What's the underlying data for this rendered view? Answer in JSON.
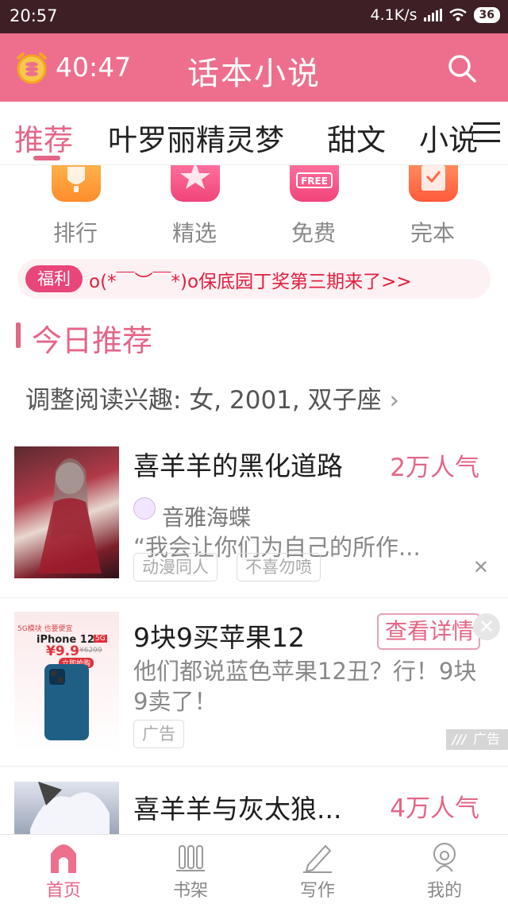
{
  "status": {
    "time": "20:57",
    "speed": "4.1K/s",
    "battery": "36"
  },
  "header": {
    "timer": "40:47",
    "title": "话本小说"
  },
  "tabs": [
    {
      "label": "推荐"
    },
    {
      "label": "叶罗丽精灵梦"
    },
    {
      "label": "甜文"
    },
    {
      "label": "小说"
    }
  ],
  "quick": [
    {
      "label": "排行",
      "icon": "trophy-icon"
    },
    {
      "label": "精选",
      "icon": "star-icon"
    },
    {
      "label": "免费",
      "icon": "free-tag-icon",
      "icon_text": "FREE"
    },
    {
      "label": "完本",
      "icon": "check-icon"
    }
  ],
  "notice": {
    "badge": "福利",
    "text": "o(*￣︶￣*)o保底园丁奖第三期来了>>"
  },
  "section": {
    "title": "今日推荐",
    "interest": "调整阅读兴趣: 女, 2001, 双子座"
  },
  "cards": [
    {
      "title": "喜羊羊的黑化道路",
      "popularity": "2万人气",
      "author": "音雅海蝶",
      "desc": "“我会让你们为自己的所作...",
      "tags": [
        "动漫同人",
        "不喜勿喷"
      ]
    },
    {
      "title": "喜羊羊与灰太狼...",
      "popularity": "4万人气"
    }
  ],
  "ad": {
    "title": "9块9买苹果12",
    "button": "查看详情",
    "desc": "他们都说蓝色苹果12丑？行！9块9卖了！",
    "tag": "广告",
    "mark": "广告",
    "image_top": "5G模块 也要便宜",
    "image_model": "iPhone 12",
    "image_5g": "5G",
    "image_price": "¥9.9",
    "image_old": "¥6299",
    "image_btn": "立即抢购"
  },
  "bottom_nav": [
    {
      "label": "首页",
      "icon": "home-icon"
    },
    {
      "label": "书架",
      "icon": "bookshelf-icon"
    },
    {
      "label": "写作",
      "icon": "pen-icon"
    },
    {
      "label": "我的",
      "icon": "profile-icon"
    }
  ],
  "colors": {
    "accent": "#e46687",
    "header": "#ee6f8d",
    "statusbar": "#3d1f25",
    "notice_text": "#e21e3c"
  }
}
